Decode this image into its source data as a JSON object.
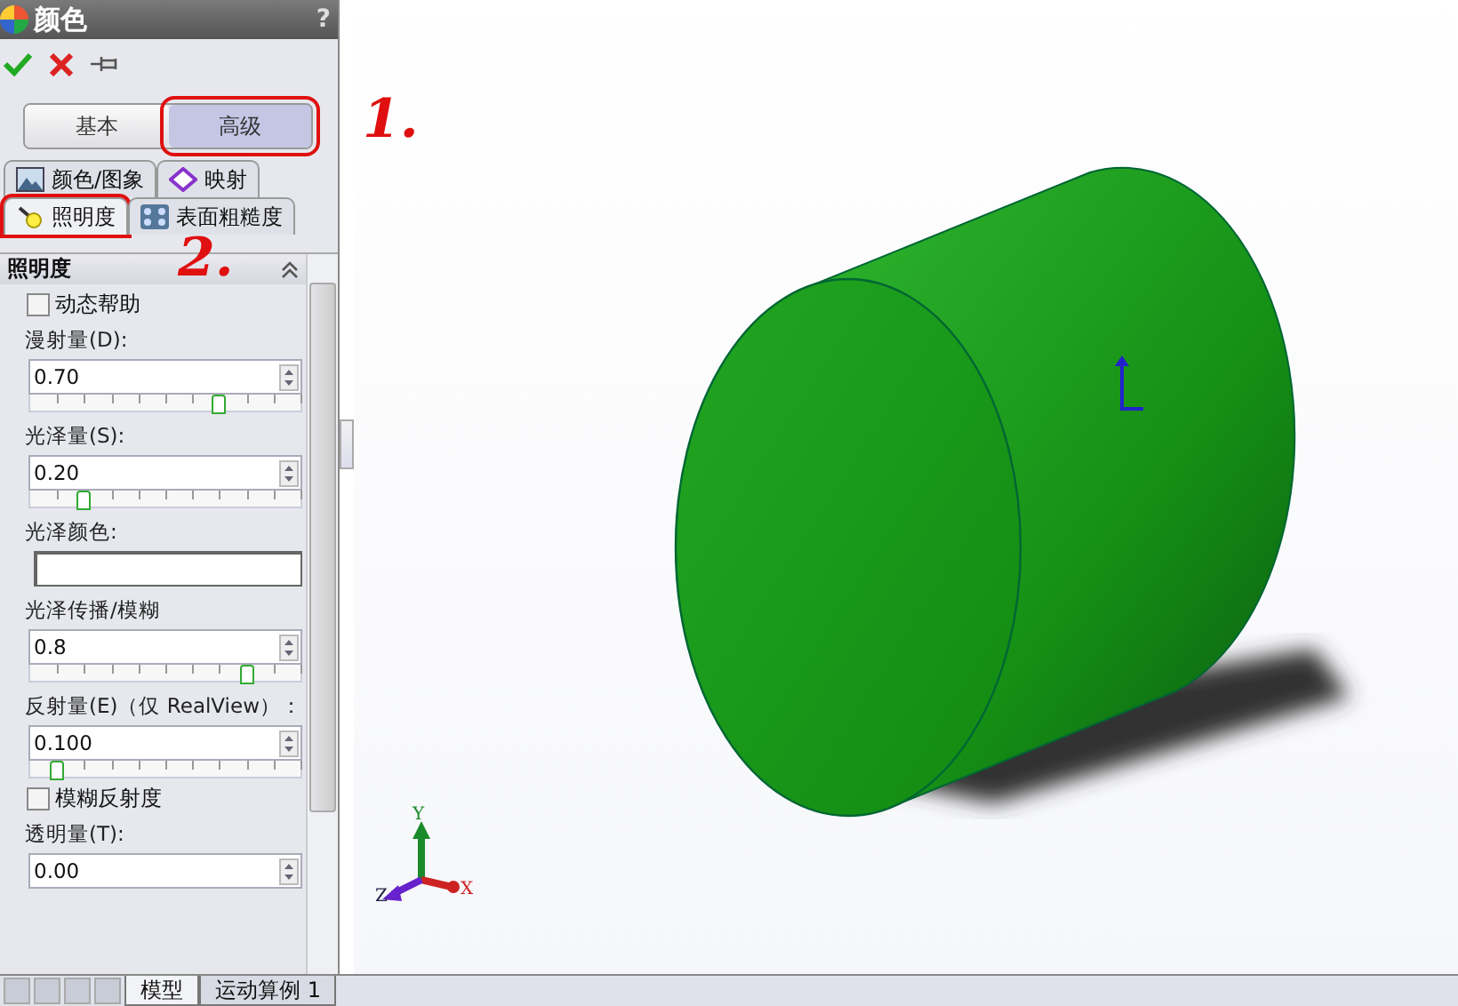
{
  "window": {
    "title": "颜色",
    "help": "?"
  },
  "mode_buttons": [
    {
      "label": "基本",
      "selected": false,
      "highlighted": false
    },
    {
      "label": "高级",
      "selected": true,
      "highlighted": true
    }
  ],
  "tab_rows": [
    [
      {
        "label": "颜色/图象",
        "selected": false,
        "highlighted": false
      },
      {
        "label": "映射",
        "selected": false,
        "highlighted": false
      }
    ],
    [
      {
        "label": "照明度",
        "selected": true,
        "highlighted": true
      },
      {
        "label": "表面粗糙度",
        "selected": false,
        "highlighted": false
      }
    ]
  ],
  "section": {
    "title": "照明度",
    "expanded": true
  },
  "fields": [
    {
      "kind": "checkbox",
      "label": "动态帮助",
      "checked": false
    },
    {
      "kind": "spin-slider",
      "label": "漫射量(D):",
      "value": "0.70",
      "level": 0.7
    },
    {
      "kind": "spin-slider",
      "label": "光泽量(S):",
      "value": "0.20",
      "level": 0.2
    },
    {
      "kind": "color",
      "label": "光泽颜色:"
    },
    {
      "kind": "spin-slider",
      "label": "光泽传播/模糊",
      "value": "0.8",
      "level": 0.8
    },
    {
      "kind": "spin-slider",
      "label": "反射量(E)（仅 RealView）：",
      "value": "0.100",
      "level": 0.1
    },
    {
      "kind": "checkbox",
      "label": "模糊反射度",
      "checked": false
    },
    {
      "kind": "spin",
      "label": "透明量(T):",
      "value": "0.00"
    }
  ],
  "bottom_tabs": [
    {
      "label": "模型",
      "selected": true
    },
    {
      "label": "运动算例 1",
      "selected": false
    }
  ],
  "annotations": [
    {
      "label": "1."
    },
    {
      "label": "2."
    }
  ],
  "triad": {
    "x": "X",
    "y": "Y",
    "z": "Z"
  }
}
